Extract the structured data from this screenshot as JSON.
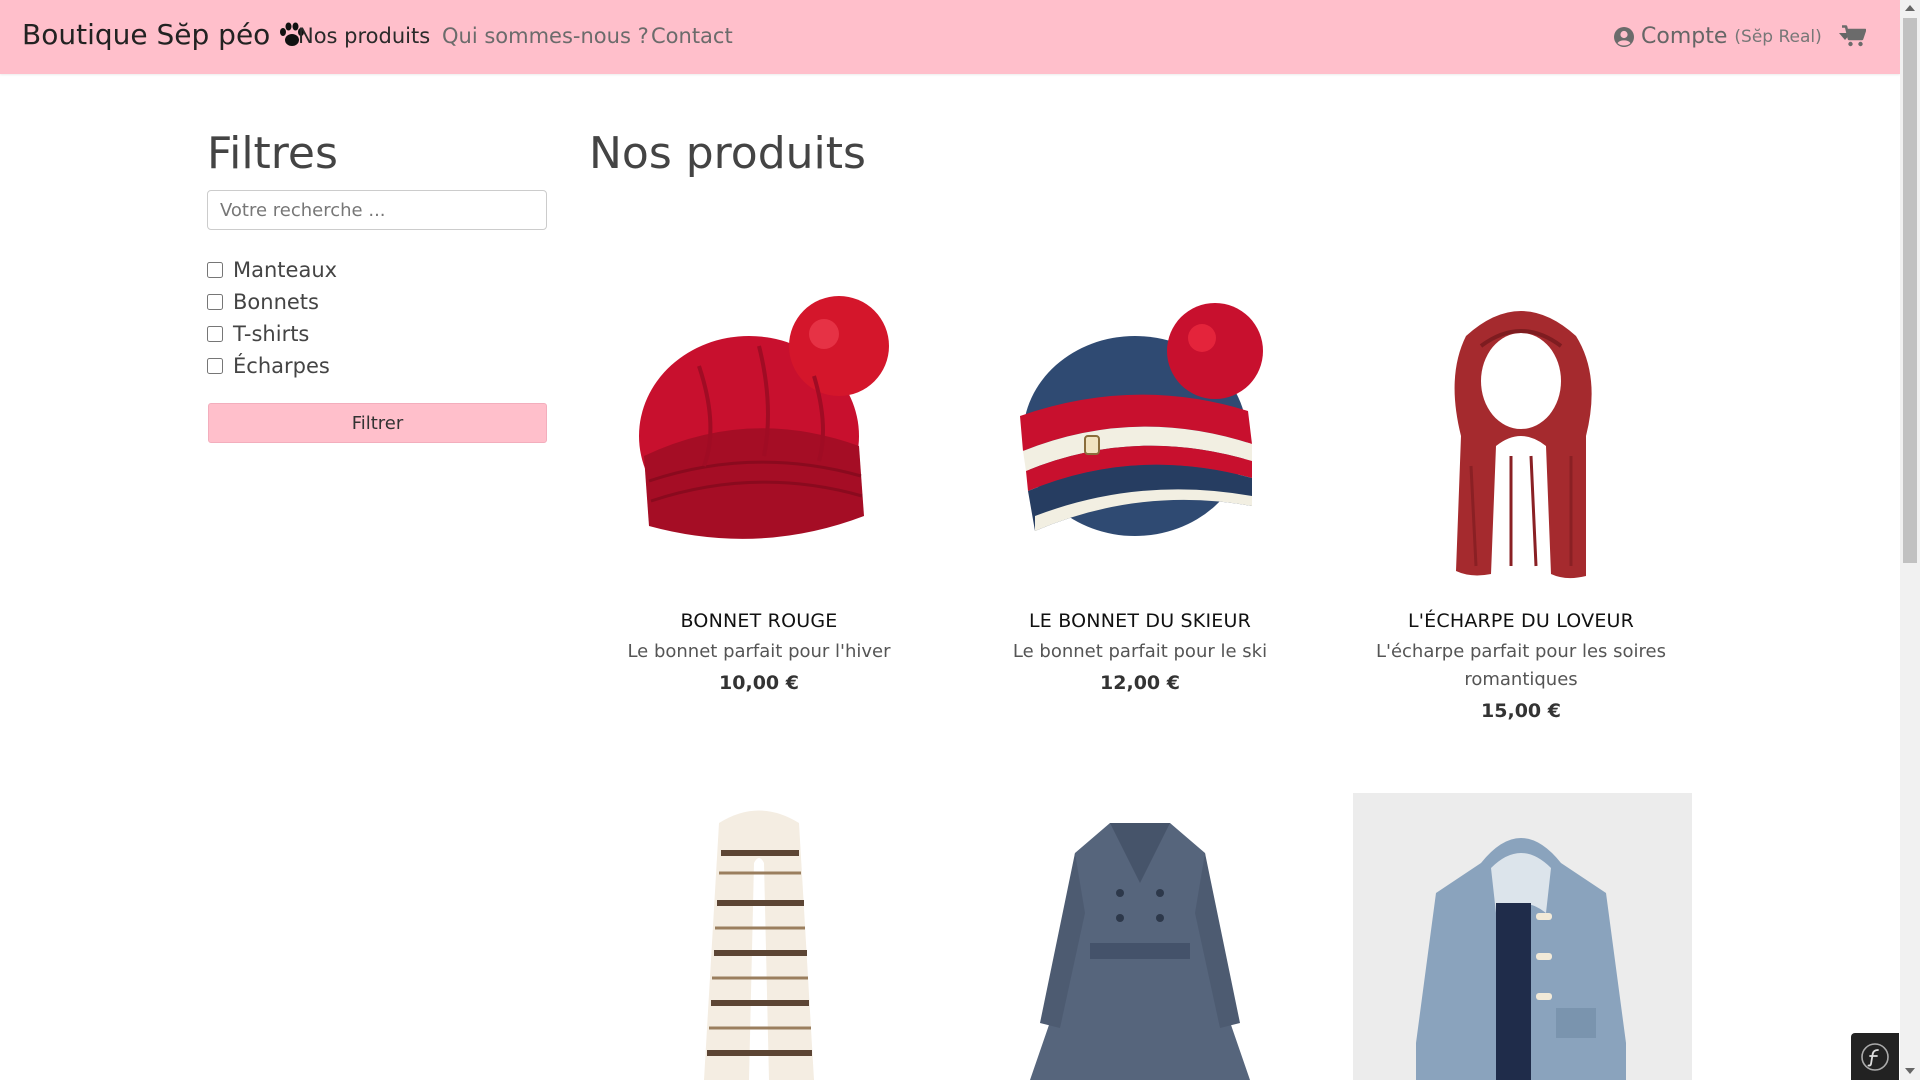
{
  "navbar": {
    "brand": "Boutique Sĕp péo",
    "brand_icon": "paw-icon",
    "links": [
      {
        "label": "Nos produits",
        "active": true
      },
      {
        "label": "Qui sommes-nous ?",
        "active": false
      },
      {
        "label": "Contact",
        "active": false
      }
    ],
    "account": {
      "label": "Compte",
      "user": "(Sĕp Real)",
      "icon": "user-circle-icon"
    },
    "cart_icon": "shopping-cart-icon",
    "background": "#ffbfcb"
  },
  "filters": {
    "title": "Filtres",
    "search_placeholder": "Votre recherche ...",
    "search_value": "",
    "categories": [
      {
        "label": "Manteaux",
        "checked": false
      },
      {
        "label": "Bonnets",
        "checked": false
      },
      {
        "label": "T-shirts",
        "checked": false
      },
      {
        "label": "Écharpes",
        "checked": false
      }
    ],
    "button_label": "Filtrer"
  },
  "products": {
    "title": "Nos produits",
    "items": [
      {
        "name": "BONNET ROUGE",
        "description": "Le bonnet parfait pour l'hiver",
        "price": "10,00 €",
        "image": "red-beanie"
      },
      {
        "name": "LE BONNET DU SKIEUR",
        "description": "Le bonnet parfait pour le ski",
        "price": "12,00 €",
        "image": "blue-ski-beanie"
      },
      {
        "name": "L'ÉCHARPE DU LOVEUR",
        "description": "L'écharpe parfait pour les soires romantiques",
        "price": "15,00 €",
        "image": "red-scarf"
      },
      {
        "name": "",
        "description": "",
        "price": "",
        "image": "striped-scarf"
      },
      {
        "name": "",
        "description": "",
        "price": "",
        "image": "grey-coat"
      },
      {
        "name": "",
        "description": "",
        "price": "",
        "image": "blue-duffle-coat"
      }
    ]
  },
  "symfony_toolbar_icon": "symfony-icon"
}
